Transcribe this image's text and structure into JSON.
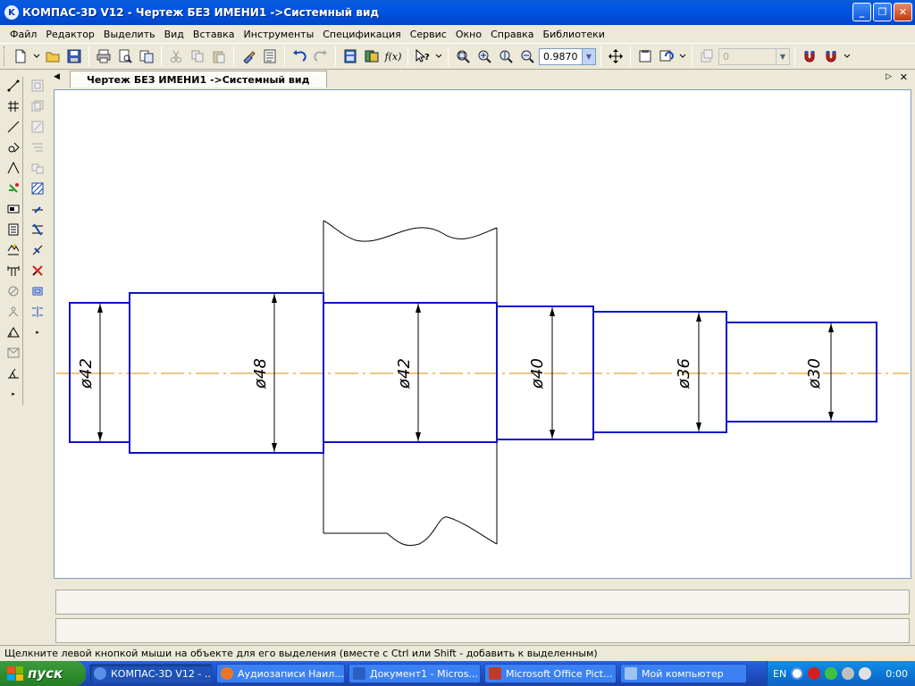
{
  "window": {
    "title": "КОМПАС-3D V12 - Чертеж БЕЗ ИМЕНИ1 ->Системный вид",
    "app_icon_letter": "K",
    "minimize_label": "_",
    "maximize_label": "❐",
    "close_label": "✕"
  },
  "menu": [
    "Файл",
    "Редактор",
    "Выделить",
    "Вид",
    "Вставка",
    "Инструменты",
    "Спецификация",
    "Сервис",
    "Окно",
    "Справка",
    "Библиотеки"
  ],
  "toolbar": {
    "zoom_value": "0.9870",
    "layer_value": "0",
    "fx_label": "f(x)"
  },
  "document_tab": {
    "label": "Чертеж БЕЗ ИМЕНИ1 ->Системный вид",
    "scroll_left": "◀",
    "scroll_right": "▷",
    "close": "✕"
  },
  "drawing": {
    "dimensions": [
      "ø42",
      "ø48",
      "ø42",
      "ø40",
      "ø36",
      "ø30"
    ],
    "colors": {
      "outline": "#1010c8",
      "axis": "#e08a00",
      "line": "#000000"
    }
  },
  "status_text": "Щелкните левой кнопкой мыши на объекте для его выделения (вместе с Ctrl или Shift - добавить к выделенным)",
  "taskbar": {
    "start_label": "пуск",
    "tasks": [
      {
        "label": "КОМПАС-3D V12 - ...",
        "icon_color": "#5a8fe8",
        "active": true
      },
      {
        "label": "Аудиозаписи Наил...",
        "icon_color": "#e8772a",
        "active": false
      },
      {
        "label": "Документ1 - Micros...",
        "icon_color": "#2a5fc0",
        "active": false
      },
      {
        "label": "Microsoft Office Pict...",
        "icon_color": "#c03a2a",
        "active": false
      },
      {
        "label": "Мой компьютер",
        "icon_color": "#9cc4f0",
        "active": false
      }
    ],
    "language": "EN",
    "clock": "0:00"
  }
}
